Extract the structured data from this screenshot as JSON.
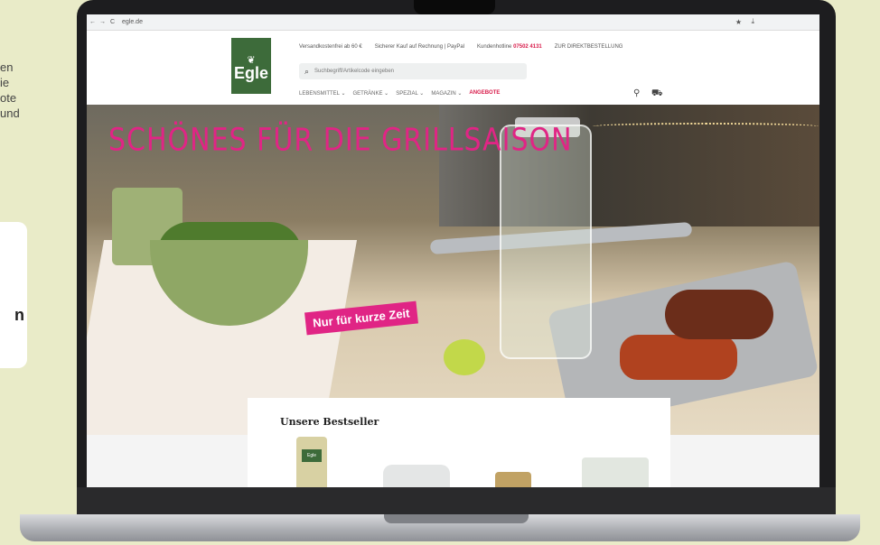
{
  "side": {
    "line1": "en",
    "line2": "ie",
    "line3": "ote",
    "line4": "und",
    "card_glyph": "n"
  },
  "browser": {
    "url": "egle.de",
    "back": "←",
    "forward": "→",
    "reload": "C"
  },
  "header": {
    "logo_text": "Egle",
    "info_shipping": "Versandkostenfrei ab 60 €",
    "info_payment": "Sicherer Kauf auf Rechnung | PayPal",
    "info_hotline_label": "Kundenhotline",
    "info_hotline_number": "07502 4131",
    "info_order": "ZUR DIREKTBESTELLUNG",
    "search_placeholder": "Suchbegriff/Artikelcode eingeben"
  },
  "menu": {
    "items": [
      "LEBENSMITTEL ⌄",
      "GETRÄNKE ⌄",
      "SPEZIAL ⌄",
      "MAGAZIN ⌄"
    ],
    "highlight": "ANGEBOTE"
  },
  "hero": {
    "headline": "SCHÖNES FÜR DIE GRILLSAISON",
    "badge": "Nur für kurze Zeit"
  },
  "bestsellers": {
    "title": "Unsere Bestseller",
    "product1_label": "Egle"
  },
  "icons": {
    "search": "search-icon",
    "account": "user-icon",
    "cart": "cart-icon"
  },
  "colors": {
    "brand_green": "#3d6b3a",
    "accent_pink": "#e02585"
  }
}
